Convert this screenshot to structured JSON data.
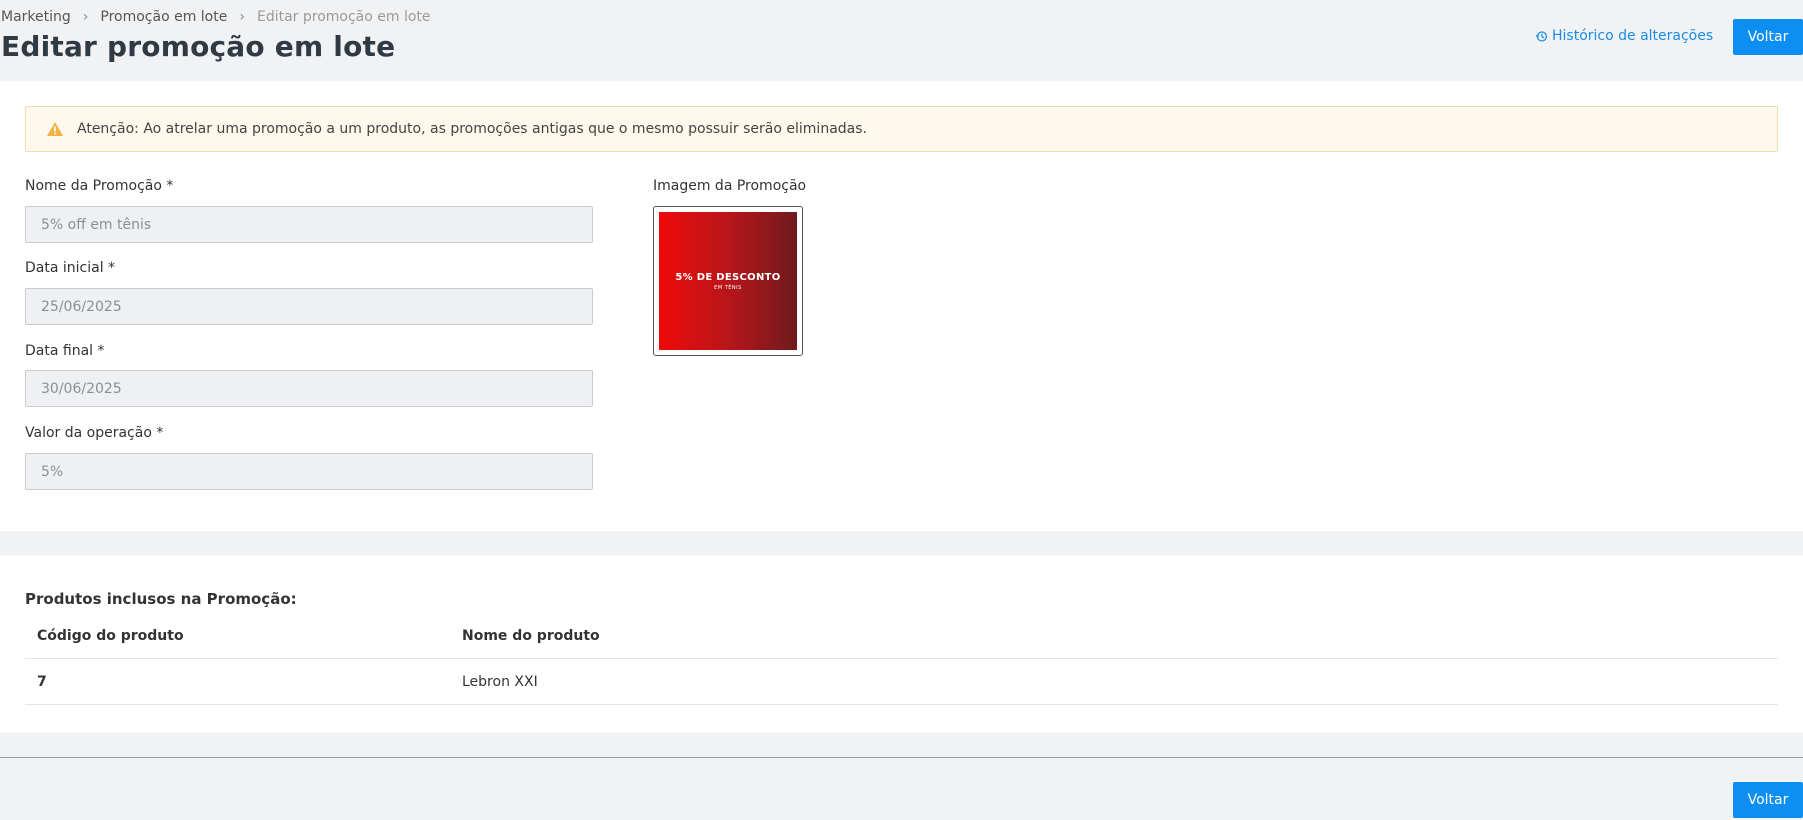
{
  "breadcrumb": {
    "items": [
      "Marketing",
      "Promoção em lote"
    ],
    "current": "Editar promoção em lote"
  },
  "page_title": "Editar promoção em lote",
  "header": {
    "history_label": "Histórico de alterações",
    "back_label": "Voltar"
  },
  "alert": {
    "icon": "warning-icon",
    "text": "Atenção: Ao atrelar uma promoção a um produto, as promoções antigas que o mesmo possuir serão eliminadas."
  },
  "form": {
    "name_label": "Nome da Promoção *",
    "name_value": "5% off em tênis",
    "start_label": "Data inicial *",
    "start_value": "25/06/2025",
    "end_label": "Data final *",
    "end_value": "30/06/2025",
    "value_label": "Valor da operação *",
    "value_value": "5%",
    "image_label": "Imagem da Promoção",
    "image_banner_title": "5% DE DESCONTO",
    "image_banner_sub": "EM TÊNIS"
  },
  "products": {
    "title": "Produtos inclusos na Promoção:",
    "columns": [
      "Código do produto",
      "Nome do produto"
    ],
    "rows": [
      {
        "code": "7",
        "name": "Lebron XXI"
      }
    ]
  },
  "footer": {
    "back_label": "Voltar"
  },
  "colors": {
    "primary": "#0d8ef2",
    "link": "#1c8ce8",
    "alert_bg": "#fff8ec",
    "warning": "#f2b144"
  }
}
